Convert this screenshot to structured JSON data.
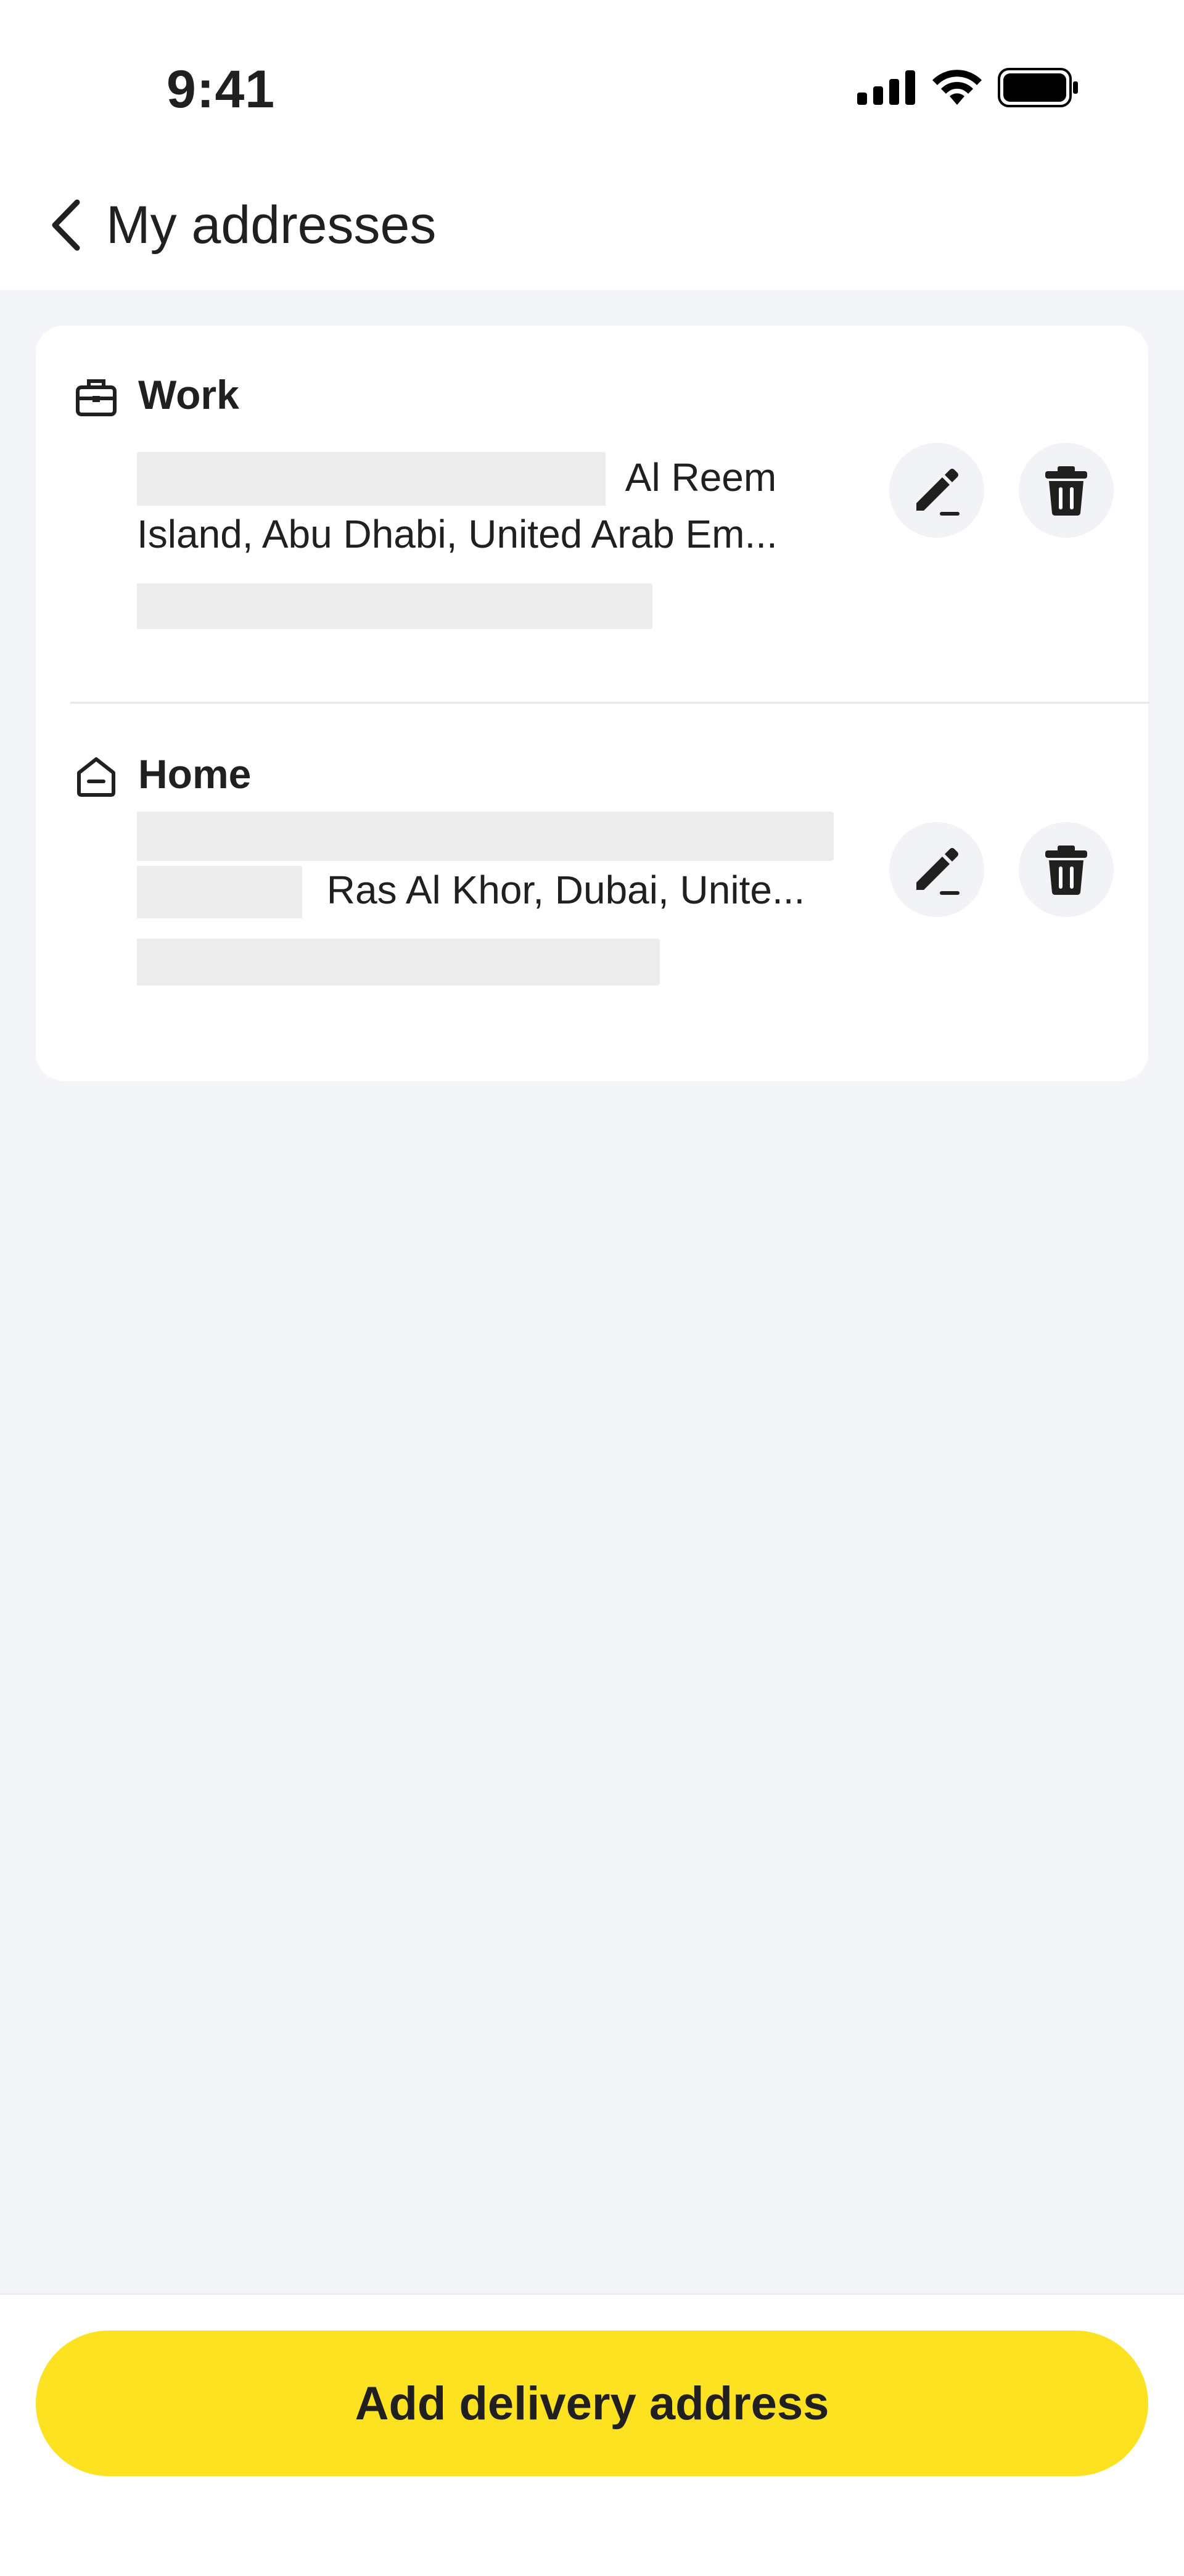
{
  "status_bar": {
    "time": "9:41"
  },
  "header": {
    "title": "My addresses"
  },
  "addresses": [
    {
      "label": "Work",
      "line1_suffix": "Al Reem",
      "line2": "Island, Abu Dhabi, United Arab Em..."
    },
    {
      "label": "Home",
      "line2_suffix": "Ras Al Khor, Dubai, Unite..."
    }
  ],
  "footer": {
    "add_button_label": "Add delivery address"
  },
  "colors": {
    "accent": "#fde222",
    "background": "#f4f5f9",
    "text": "#21201f"
  },
  "icons": [
    "back-chevron",
    "signal",
    "wifi",
    "battery",
    "briefcase",
    "home",
    "pencil",
    "trash"
  ]
}
